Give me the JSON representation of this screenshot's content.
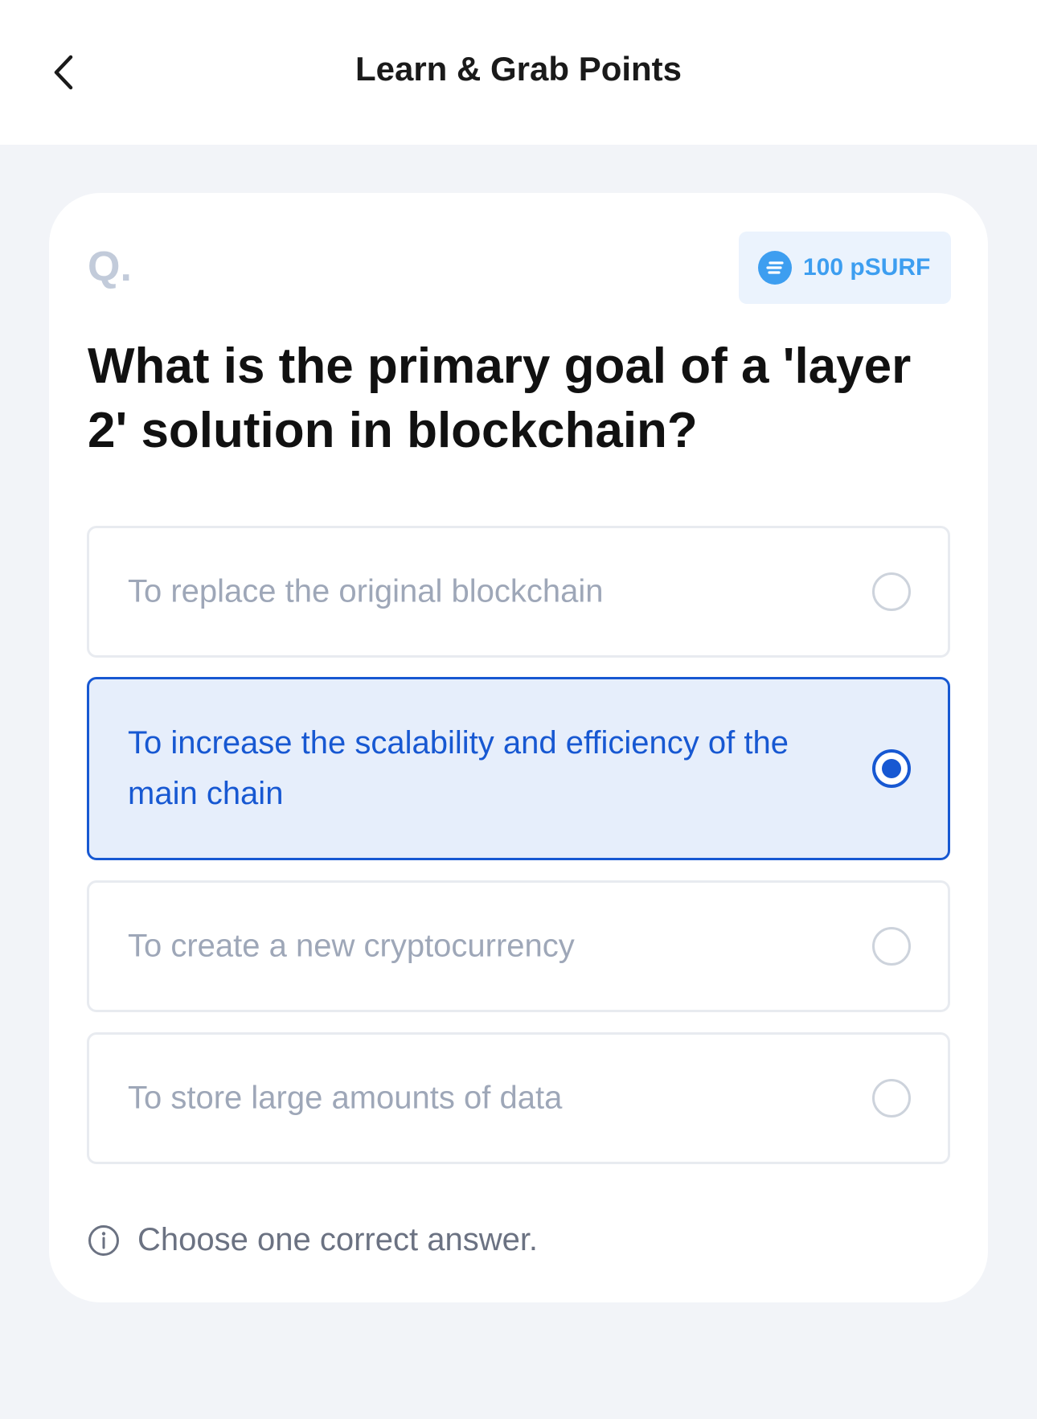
{
  "header": {
    "title": "Learn & Grab Points"
  },
  "quiz": {
    "q_label": "Q.",
    "reward": "100 pSURF",
    "question": "What is the primary goal of a 'layer 2' solution in blockchain?",
    "options": [
      {
        "label": "To replace the original blockchain",
        "selected": false
      },
      {
        "label": "To increase the scalability and efficiency of the main chain",
        "selected": true
      },
      {
        "label": "To create a new cryptocurrency",
        "selected": false
      },
      {
        "label": "To store large amounts of data",
        "selected": false
      }
    ],
    "hint": "Choose one correct answer."
  },
  "colors": {
    "accent": "#1758d2",
    "badge": "#3d9ef0",
    "background": "#f2f4f8"
  }
}
